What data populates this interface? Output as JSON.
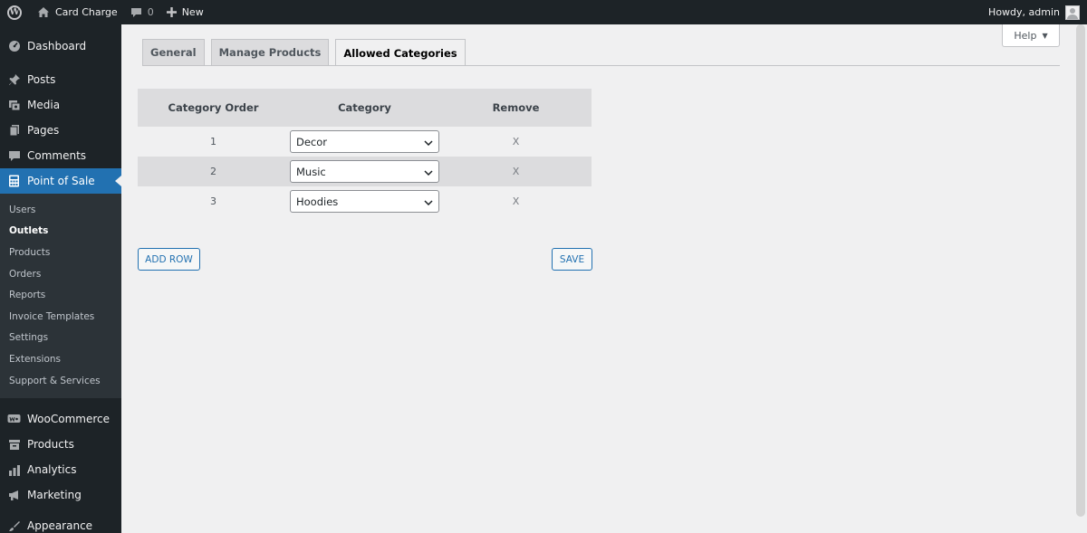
{
  "adminbar": {
    "site_name": "Card Charge",
    "comments_count": "0",
    "new_label": "New",
    "howdy": "Howdy, admin"
  },
  "sidebar": {
    "top_items": [
      {
        "label": "Dashboard",
        "icon": "dashboard-icon"
      },
      {
        "label": "Posts",
        "icon": "pin-icon"
      },
      {
        "label": "Media",
        "icon": "media-icon"
      },
      {
        "label": "Pages",
        "icon": "pages-icon"
      },
      {
        "label": "Comments",
        "icon": "comment-icon"
      },
      {
        "label": "Point of Sale",
        "icon": "calculator-icon",
        "current": true
      }
    ],
    "submenu": [
      {
        "label": "Users"
      },
      {
        "label": "Outlets",
        "current": true
      },
      {
        "label": "Products"
      },
      {
        "label": "Orders"
      },
      {
        "label": "Reports"
      },
      {
        "label": "Invoice Templates"
      },
      {
        "label": "Settings"
      },
      {
        "label": "Extensions"
      },
      {
        "label": "Support & Services"
      }
    ],
    "bottom_items": [
      {
        "label": "WooCommerce",
        "icon": "woo-icon"
      },
      {
        "label": "Products",
        "icon": "archive-icon"
      },
      {
        "label": "Analytics",
        "icon": "chart-bar-icon"
      },
      {
        "label": "Marketing",
        "icon": "megaphone-icon"
      },
      {
        "label": "Appearance",
        "icon": "brush-icon"
      }
    ]
  },
  "help": {
    "label": "Help"
  },
  "tabs": [
    {
      "label": "General"
    },
    {
      "label": "Manage Products"
    },
    {
      "label": "Allowed Categories",
      "active": true
    }
  ],
  "table": {
    "headers": [
      "Category Order",
      "Category",
      "Remove"
    ],
    "rows": [
      {
        "order": "1",
        "category": "Decor",
        "remove": "X"
      },
      {
        "order": "2",
        "category": "Music",
        "remove": "X"
      },
      {
        "order": "3",
        "category": "Hoodies",
        "remove": "X"
      }
    ]
  },
  "buttons": {
    "add_row": "ADD ROW",
    "save": "SAVE"
  },
  "colors": {
    "accent": "#2271b1",
    "adminbar_bg": "#1d2327",
    "content_bg": "#f0f0f1"
  }
}
